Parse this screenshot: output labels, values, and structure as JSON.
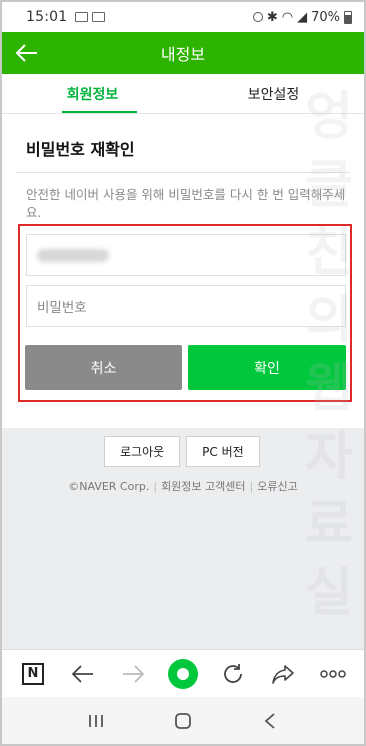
{
  "status_bar": {
    "time": "15:01",
    "battery": "70%"
  },
  "app_bar": {
    "title": "내정보"
  },
  "tabs": [
    {
      "label": "회원정보",
      "active": true
    },
    {
      "label": "보안설정",
      "active": false
    }
  ],
  "card": {
    "title": "비밀번호 재확인",
    "description": "안전한 네이버 사용을 위해 비밀번호를 다시 한 번 입력해주세요.",
    "password_placeholder": "비밀번호",
    "cancel_label": "취소",
    "confirm_label": "확인"
  },
  "bottom": {
    "logout_label": "로그아웃",
    "pc_label": "PC 버전",
    "copyright": "©NAVER Corp.",
    "help_label": "회원정보 고객센터",
    "report_label": "오류신고"
  },
  "watermark": {
    "chars": [
      "엉",
      "클",
      "친",
      "의",
      "웹",
      "자",
      "료",
      "실"
    ]
  },
  "colors": {
    "brand_green": "#2db400",
    "confirm_green": "#00c73c",
    "highlight_red": "#e02a2a"
  }
}
